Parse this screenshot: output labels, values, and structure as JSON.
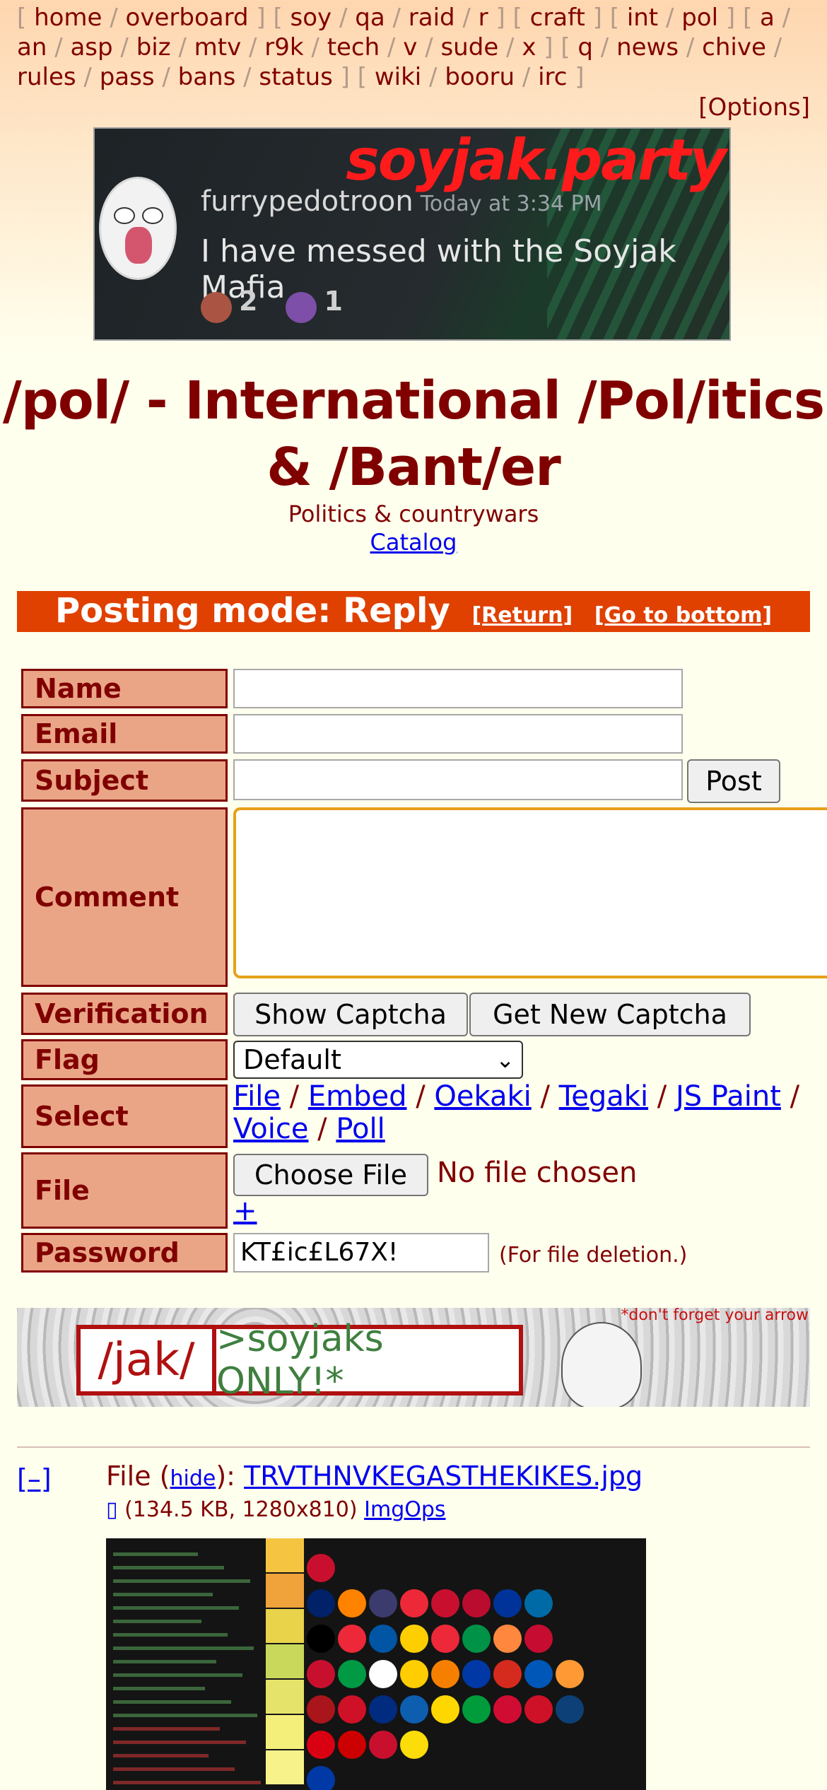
{
  "nav": {
    "groups": [
      [
        "home",
        "overboard"
      ],
      [
        "soy",
        "qa",
        "raid",
        "r"
      ],
      [
        "craft"
      ],
      [
        "int",
        "pol"
      ],
      [
        "a",
        "an",
        "asp",
        "biz",
        "mtv",
        "r9k",
        "tech",
        "v",
        "sude",
        "x"
      ],
      [
        "q",
        "news",
        "chive",
        "rules",
        "pass",
        "bans",
        "status"
      ],
      [
        "wiki",
        "booru",
        "irc"
      ]
    ],
    "options": "[Options]"
  },
  "banner": {
    "site": "soyjak.party",
    "user": "furrypedotroon",
    "time": "Today at 3:34 PM",
    "message": "I have messed with the Soyjak Mafia",
    "reaction1": "2",
    "reaction2": "1"
  },
  "board": {
    "title": "/pol/ - International /Pol/itics & /Bant/er",
    "subtitle": "Politics & countrywars",
    "catalog": "Catalog"
  },
  "mode": {
    "text": "Posting mode: Reply",
    "return": "[Return]",
    "bottom": "[Go to bottom]"
  },
  "form": {
    "name_label": "Name",
    "email_label": "Email",
    "subject_label": "Subject",
    "post_button": "Post",
    "comment_label": "Comment",
    "verification_label": "Verification",
    "show_captcha": "Show Captcha",
    "new_captcha": "Get New Captcha",
    "flag_label": "Flag",
    "flag_value": "Default",
    "select_label": "Select",
    "select_links": [
      "File",
      "Embed",
      "Oekaki",
      "Tegaki",
      "JS Paint",
      "Voice",
      "Poll"
    ],
    "file_label": "File",
    "choose_file": "Choose File",
    "no_file": "No file chosen",
    "add_more": "+",
    "password_label": "Password",
    "password_value": "KT£ic£L67X!",
    "password_note": "(For file deletion.)"
  },
  "ad": {
    "board": "/jak/",
    "tagline": ">soyjaks ONLY!*",
    "footnote": "*don't forget your arrow"
  },
  "post": {
    "collapse": "[–]",
    "file_prefix": "File (",
    "hide": "hide",
    "file_mid": "): ",
    "filename": "TRVTHNVKEGASTHEKIKES.jpg",
    "meta": "(134.5 KB, 1280x810)",
    "imgops": "ImgOps",
    "download_icon": "▯"
  }
}
